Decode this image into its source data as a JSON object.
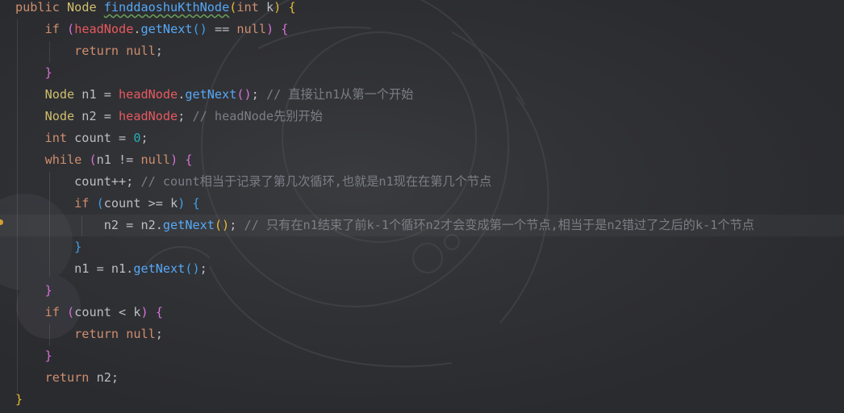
{
  "code": {
    "line1": {
      "kw_public": "public",
      "type_node": "Node",
      "fn_name": "finddaoshuKthNode",
      "open": "(",
      "kw_int": "int",
      "param_k": "k",
      "close": ")",
      "brace": "{"
    },
    "line2": {
      "kw_if": "if",
      "open": "(",
      "field": "headNode",
      "dot": ".",
      "call": "getNext",
      "parens": "()",
      "op": " == ",
      "kw_null": "null",
      "close": ")",
      "brace": "{"
    },
    "line3": {
      "kw_return": "return",
      "kw_null": "null",
      "semi": ";"
    },
    "line4": {
      "brace": "}"
    },
    "line5": {
      "type": "Node",
      "decl": " n1 = ",
      "field": "headNode",
      "dot": ".",
      "call": "getNext",
      "parens": "()",
      "semi": ";",
      "comment": "// 直接让n1从第一个开始"
    },
    "line6": {
      "type": "Node",
      "decl": " n2 = ",
      "field": "headNode",
      "semi": ";",
      "comment": "// headNode先别开始"
    },
    "line7": {
      "kw_int": "int",
      "decl": " count = ",
      "num": "0",
      "semi": ";"
    },
    "line8": {
      "kw_while": "while",
      "open": "(",
      "cond": "n1 != ",
      "kw_null": "null",
      "close": ")",
      "brace": "{"
    },
    "line9": {
      "stmt": "count++;",
      "comment": "// count相当于记录了第几次循环,也就是n1现在在第几个节点"
    },
    "line10": {
      "kw_if": "if",
      "open": "(",
      "cond": "count >= ",
      "param_k": "k",
      "close": ")",
      "brace": "{"
    },
    "line11": {
      "assign": "n2 = n2.",
      "call": "getNext",
      "parens": "()",
      "semi": ";",
      "comment": "// 只有在n1结束了前k-1个循环n2才会变成第一个节点,相当于是n2错过了之后的k-1个节点"
    },
    "line12": {
      "brace": "}"
    },
    "line13": {
      "assign": "n1 = n1.",
      "call": "getNext",
      "parens": "()",
      "semi": ";"
    },
    "line14": {
      "brace": "}"
    },
    "line15": {
      "kw_if": "if",
      "open": "(",
      "cond": "count < ",
      "param_k": "k",
      "close": ")",
      "brace": "{"
    },
    "line16": {
      "kw_return": "return",
      "kw_null": "null",
      "semi": ";"
    },
    "line17": {
      "brace": "}"
    },
    "line18": {
      "kw_return": "return",
      "rest": " n2;"
    },
    "line19": {
      "brace": "}"
    }
  }
}
